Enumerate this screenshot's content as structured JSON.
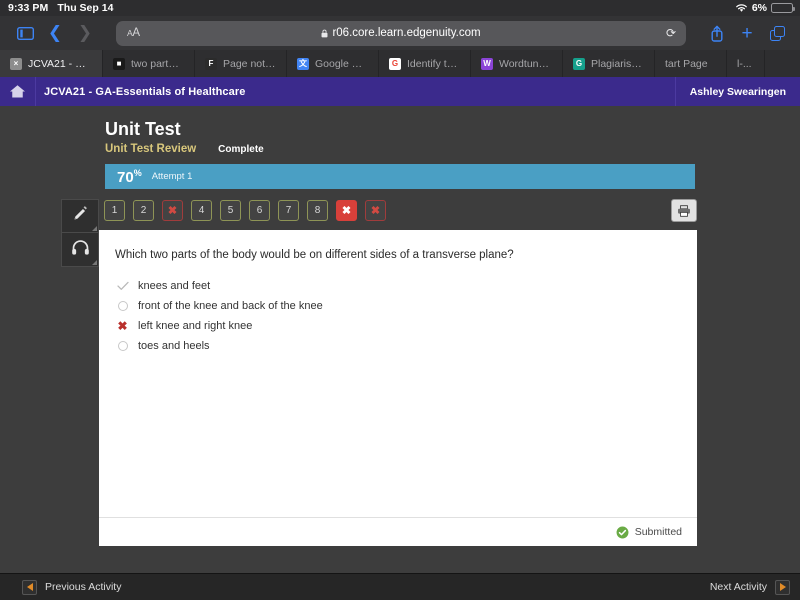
{
  "status_bar": {
    "time": "9:33 PM",
    "date": "Thu Sep 14",
    "battery_percent": "6%",
    "battery_level": 6,
    "wifi_icon": "wifi-icon",
    "battery_icon": "battery-icon",
    "battery_color": "#f03c2e"
  },
  "browser": {
    "sidebar_icon": "sidebar-icon",
    "back_icon": "chevron-left-icon",
    "forward_icon": "chevron-right-icon",
    "text_size_label": "AA",
    "lock_icon": "lock-icon",
    "url": "r06.core.learn.edgenuity.com",
    "reload_icon": "reload-icon",
    "share_icon": "share-icon",
    "new_tab_icon": "plus-icon",
    "tabs_overview_icon": "tabs-icon",
    "tabs": [
      {
        "label": "JCVA21 - GA...",
        "favicon": "x-square-icon",
        "favicon_bg": "#8d8d8d",
        "favicon_fg": "#ffffff",
        "favicon_glyph": "×",
        "active": true
      },
      {
        "label": "two parts of...",
        "favicon": "black-square-icon",
        "favicon_bg": "#1a1a1a",
        "favicon_fg": "#ffffff",
        "favicon_glyph": "■",
        "active": false
      },
      {
        "label": "Page not fou...",
        "favicon": "f-circle-icon",
        "favicon_bg": "#2b2b2b",
        "favicon_fg": "#ffffff",
        "favicon_glyph": "F",
        "active": false
      },
      {
        "label": "Google Tran...",
        "favicon": "google-translate-icon",
        "favicon_bg": "#4285f4",
        "favicon_fg": "#ffffff",
        "favicon_glyph": "文",
        "active": false
      },
      {
        "label": "Identify the t...",
        "favicon": "google-icon",
        "favicon_bg": "#ffffff",
        "favicon_fg": "#ea4335",
        "favicon_glyph": "G",
        "active": false
      },
      {
        "label": "Wordtune Ed...",
        "favicon": "wordtune-icon",
        "favicon_bg": "#8b44d7",
        "favicon_fg": "#ffffff",
        "favicon_glyph": "W",
        "active": false
      },
      {
        "label": "Plagiarism C...",
        "favicon": "grammarly-icon",
        "favicon_bg": "#15a08c",
        "favicon_fg": "#ffffff",
        "favicon_glyph": "G",
        "active": false
      },
      {
        "label": "tart Page",
        "favicon": "",
        "favicon_bg": "",
        "favicon_fg": "",
        "favicon_glyph": "",
        "active": false
      },
      {
        "label": "l-...",
        "favicon": "",
        "favicon_bg": "",
        "favicon_fg": "",
        "favicon_glyph": "",
        "active": false
      }
    ]
  },
  "course_header": {
    "home_icon": "home-icon",
    "title": "JCVA21 - GA-Essentials of Healthcare",
    "user_name": "Ashley Swearingen",
    "bg_color": "#3b2a8c"
  },
  "assignment": {
    "title": "Unit Test",
    "review_label": "Unit Test Review",
    "status_label": "Complete",
    "score": "70",
    "score_suffix": "%",
    "attempt_label": "Attempt 1",
    "score_bar_color": "#4a9fc4",
    "review_color": "#d8c77c"
  },
  "tools": {
    "highlighter_icon": "pencil-icon",
    "audio_icon": "headphones-icon",
    "print_icon": "printer-icon"
  },
  "question_nav": {
    "items": [
      {
        "label": "1",
        "state": "correct"
      },
      {
        "label": "2",
        "state": "correct"
      },
      {
        "label": "✖",
        "state": "wrong"
      },
      {
        "label": "4",
        "state": "correct"
      },
      {
        "label": "5",
        "state": "correct"
      },
      {
        "label": "6",
        "state": "correct"
      },
      {
        "label": "7",
        "state": "correct"
      },
      {
        "label": "8",
        "state": "correct"
      },
      {
        "label": "✖",
        "state": "current"
      },
      {
        "label": "✖",
        "state": "wrong"
      }
    ]
  },
  "question": {
    "prompt": "Which two parts of the body would be on different sides of a transverse plane?",
    "choices": [
      {
        "text": "knees and feet",
        "mark": "check",
        "mark_icon": "check-icon"
      },
      {
        "text": "front of the knee and back of the knee",
        "mark": "radio",
        "mark_icon": "radio-unselected-icon"
      },
      {
        "text": "left knee and right knee",
        "mark": "x",
        "mark_icon": "x-icon"
      },
      {
        "text": "toes and heels",
        "mark": "radio",
        "mark_icon": "radio-unselected-icon"
      }
    ],
    "submitted_label": "Submitted",
    "submitted_icon": "check-circle-icon",
    "submitted_color": "#6aab45"
  },
  "bottom_nav": {
    "previous_label": "Previous Activity",
    "next_label": "Next Activity",
    "arrow_color": "#e08b28"
  }
}
